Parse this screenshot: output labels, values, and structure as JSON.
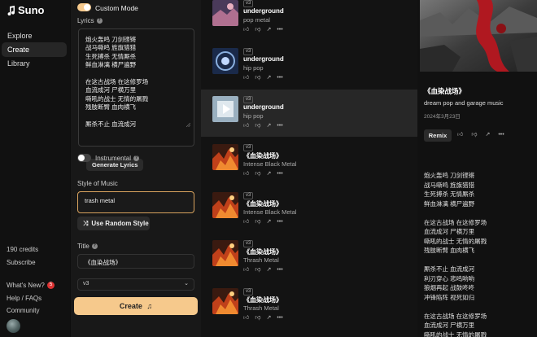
{
  "app": {
    "name": "Suno"
  },
  "nav": {
    "explore": "Explore",
    "create": "Create",
    "library": "Library"
  },
  "sidebar_bottom": {
    "credits": "190 credits",
    "subscribe": "Subscribe",
    "whats_new": "What's New?",
    "whats_new_count": "5",
    "help": "Help / FAQs",
    "community": "Community"
  },
  "form": {
    "custom_mode_label": "Custom Mode",
    "custom_mode_on": true,
    "lyrics_label": "Lyrics",
    "lyrics_text": "炮火轰鸣 刀剑铿锵\n战马嘶鸣 旌旗猎猎\n生死搏杀 无情厮杀\n鲜血淋漓 横尸遍野\n\n在这古战场 在这修罗场\n血流成河 尸横万里\n嘶吼的战士 无情的屠戮\n残肢断臂 血肉横飞\n\n厮杀不止 血流成河",
    "generate_lyrics": "Generate Lyrics",
    "instrumental_label": "Instrumental",
    "instrumental_on": false,
    "style_label": "Style of Music",
    "style_value": "trash metal",
    "random_style": "Use Random Style",
    "title_label": "Title",
    "title_value": "《血染战场》",
    "version": "v3",
    "create_label": "Create"
  },
  "songs": [
    {
      "version": "v3",
      "title": "underground",
      "genre": "pop metal",
      "art": "pink"
    },
    {
      "version": "v3",
      "title": "underground",
      "genre": "hip pop",
      "art": "blue"
    },
    {
      "version": "v3",
      "title": "underground",
      "genre": "hip pop",
      "art": "light",
      "highlighted": true
    },
    {
      "version": "v3",
      "title": "《血染战场》",
      "genre": "Intense Black Metal",
      "art": "fire"
    },
    {
      "version": "v3",
      "title": "《血染战场》",
      "genre": "Intense Black Metal",
      "art": "fire"
    },
    {
      "version": "v3",
      "title": "《血染战场》",
      "genre": "Thrash Metal",
      "art": "fire"
    },
    {
      "version": "v3",
      "title": "《血染战场》",
      "genre": "Thrash Metal",
      "art": "fire"
    }
  ],
  "detail": {
    "title": "《血染战场》",
    "genre": "dream pop  and garage music",
    "date": "2024年3月23日",
    "remix": "Remix",
    "lyrics": "炮火轰鸣 刀剑铿锵\n战马嘶鸣 旌旗猎猎\n生死搏杀 无情厮杀\n鲜血淋漓 横尸遍野\n\n在这古战场 在这修罗场\n血流成河 尸横万里\n嘶吼的战士 无情的屠戮\n残肢断臂 血肉横飞\n\n厮杀不止 血流成河\n利刃穿心 悲鸣哟哟\n狼烟再起 战鼓咚咚\n冲锋陷阵 视死如归\n\n在这古战场 在这修罗场\n血流成河 尸横万里\n嘶吼的战士 无情的屠戮"
  },
  "colors": {
    "accent": "#f6c98c",
    "style_border": "#d9a35e",
    "badge": "#d33"
  }
}
